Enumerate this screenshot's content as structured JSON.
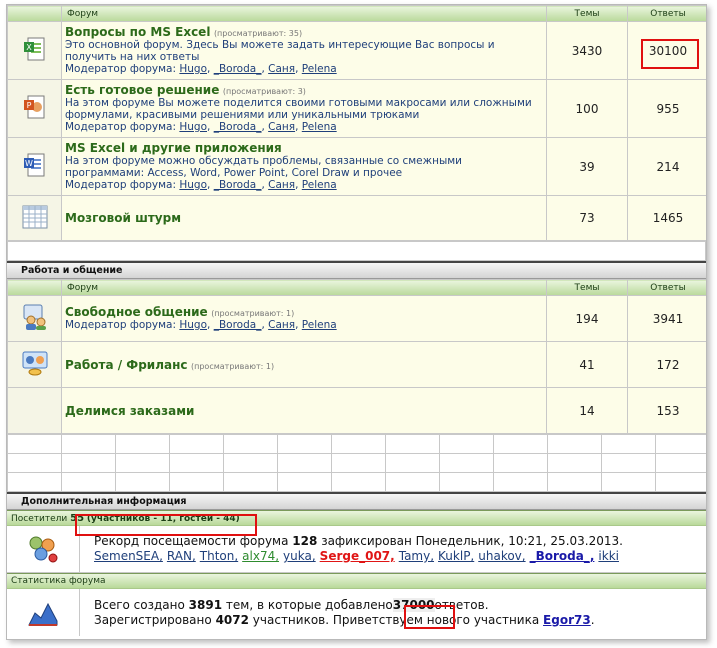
{
  "forums_header": {
    "forum": "Форум",
    "topics": "Темы",
    "replies": "Ответы"
  },
  "forums1": [
    {
      "title": "Вопросы по MS Excel",
      "viewers": "(просматривают: 35)",
      "desc": "Это основной форум. Здесь Вы можете задать интересующие Вас вопросы и получить на них ответы",
      "topics": "3430",
      "replies": "30100",
      "icon": "excel-icon"
    },
    {
      "title": "Есть готовое решение",
      "viewers": "(просматривают: 3)",
      "desc": "На этом форуме Вы можете поделится своими готовыми макросами или сложными формулами, красивыми решениями или уникальными трюками",
      "topics": "100",
      "replies": "955",
      "icon": "powerpoint-icon"
    },
    {
      "title": "MS Excel и другие приложения",
      "viewers": "",
      "desc": "На этом форуме можно обсуждать проблемы, связанные со смежными программами: Access, Word, Power Point, Corel Draw и прочее",
      "topics": "39",
      "replies": "214",
      "icon": "word-icon"
    },
    {
      "title": "Мозговой штурм",
      "viewers": "",
      "desc": "",
      "topics": "73",
      "replies": "1465",
      "icon": "spreadsheet-grid-icon"
    }
  ],
  "moderators_label": "Модератор форума:",
  "moderators": [
    "Hugo",
    "_Boroda_",
    "Саня",
    "Pelena"
  ],
  "section2": "Работа и общение",
  "forums2": [
    {
      "title": "Свободное общение",
      "viewers": "(просматривают: 1)",
      "topics": "194",
      "replies": "3941",
      "icon": "chat-people-icon"
    },
    {
      "title": "Работа / Фриланс",
      "viewers": "(просматривают: 1)",
      "topics": "41",
      "replies": "172",
      "icon": "work-freelance-icon"
    },
    {
      "title": "Делимся заказами",
      "viewers": "",
      "topics": "14",
      "replies": "153",
      "icon": ""
    }
  ],
  "extra_info": "Дополнительная информация",
  "visitors": {
    "label": "Посетители",
    "count": "55",
    "detail": "(участников - 11, гостей - 44)"
  },
  "record": {
    "prefix": "Рекорд посещаемости форума",
    "value": "128",
    "suffix": "зафиксирован Понедельник, 10:21, 25.03.2013."
  },
  "online_users": [
    {
      "name": "SemenSEA",
      "color": "#1f3f7a",
      "bold": false
    },
    {
      "name": "RAN",
      "color": "#1f3f7a",
      "bold": false
    },
    {
      "name": "Thton",
      "color": "#1f3f7a",
      "bold": false
    },
    {
      "name": "alx74",
      "color": "#2e8b2e",
      "bold": false
    },
    {
      "name": "yuka",
      "color": "#1f3f7a",
      "bold": false
    },
    {
      "name": "Serge_007",
      "color": "#e01515",
      "bold": true
    },
    {
      "name": "Tamy",
      "color": "#1f3f7a",
      "bold": false
    },
    {
      "name": "KuklP",
      "color": "#1f3f7a",
      "bold": false
    },
    {
      "name": "uhakov",
      "color": "#1f3f7a",
      "bold": false
    },
    {
      "name": "_Boroda_",
      "color": "#1a1aa8",
      "bold": true
    },
    {
      "name": "ikki",
      "color": "#1f3f7a",
      "bold": false
    }
  ],
  "stats_label": "Статистика форума",
  "stats": {
    "line1_prefix": "Всего создано",
    "topics": "3891",
    "line1_mid": "тем, в которые добавлено",
    "replies": "37000",
    "line1_suffix": "ответов.",
    "line2_prefix": "Зарегистрировано",
    "users": "4072",
    "line2_mid": "участников. Приветствуем нового участника",
    "newest": "Egor73",
    "line2_suffix": "."
  }
}
